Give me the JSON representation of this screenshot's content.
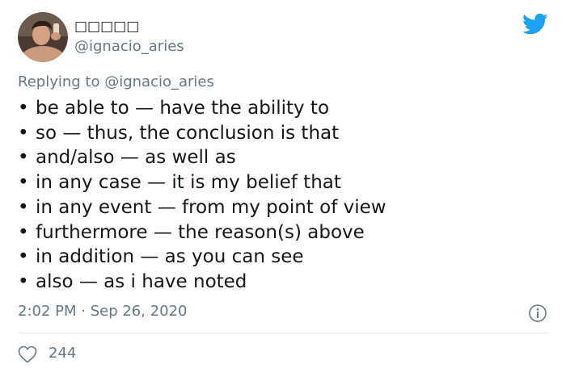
{
  "header": {
    "display_name": "□□□□□",
    "handle": "@ignacio_aries",
    "logo_icon": "twitter-bird-icon",
    "accent_color": "#1da1f2"
  },
  "replying": {
    "prefix": "Replying to",
    "handle": "@ignacio_aries"
  },
  "body": {
    "lines": [
      "be able to — have the ability to",
      "so — thus, the conclusion is that",
      "and/also — as well as",
      "in any case — it is my belief that",
      "in any event — from my point of view",
      "furthermore — the reason(s) above",
      "in addition — as you can see",
      "also — as i have noted"
    ]
  },
  "footer": {
    "timestamp": "2:02 PM · Sep 26, 2020",
    "info_icon": "info-icon",
    "like_icon": "heart-icon",
    "like_count": "244"
  }
}
